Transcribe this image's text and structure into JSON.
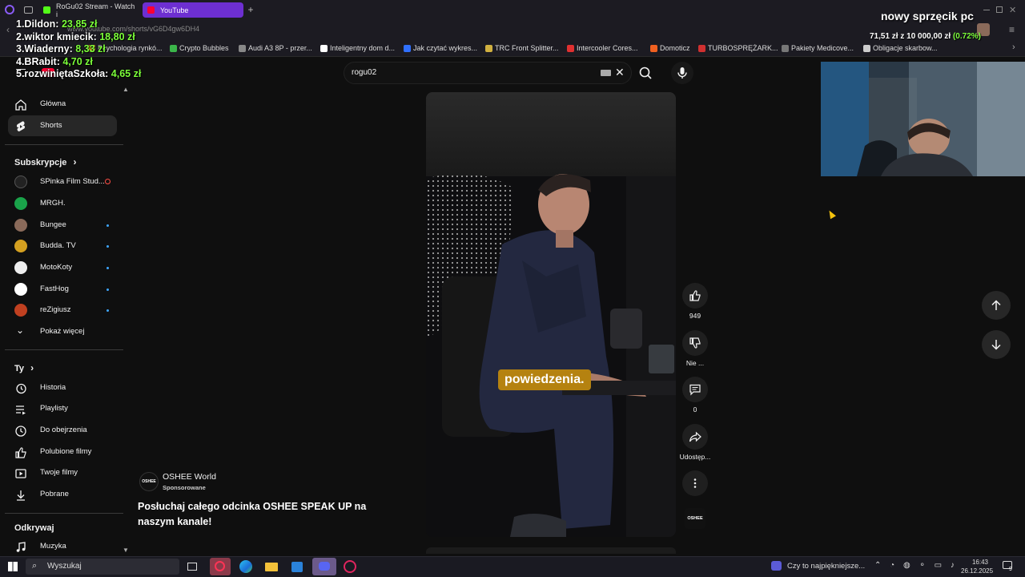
{
  "browser": {
    "tabs": [
      {
        "label": "RoGu02 Stream - Watch i",
        "color": "#53fc18"
      },
      {
        "label": "YouTube",
        "color": "#ff0033",
        "active": true
      }
    ],
    "new_tab": "+",
    "url": "www.youtube.com/shorts/vG6D4gw6DH4",
    "bookmarks": [
      {
        "label": "Psychologia rynkó...",
        "color": "#e0a020"
      },
      {
        "label": "Crypto Bubbles",
        "color": "#3bb54a"
      },
      {
        "label": "Audi A3 8P - przer...",
        "color": "#888888"
      },
      {
        "label": "Inteligentny dom d...",
        "color": "#ffffff"
      },
      {
        "label": "Jak czytać wykres...",
        "color": "#3070ff"
      },
      {
        "label": "TRC Front Splitter...",
        "color": "#d0b040"
      },
      {
        "label": "Intercooler Cores...",
        "color": "#e03030"
      },
      {
        "label": "Domoticz",
        "color": "#f06020"
      },
      {
        "label": "TURBOSPRĘŻARK...",
        "color": "#d03030"
      },
      {
        "label": "Pakiety Medicove...",
        "color": "#777777"
      },
      {
        "label": "Obligacje skarbow...",
        "color": "#cccccc"
      }
    ]
  },
  "overlay": {
    "leaderboard": [
      {
        "name": "1.Dildon:",
        "amount": "23,85 zł"
      },
      {
        "name": "2.wiktor kmiecik:",
        "amount": "18,80 zł"
      },
      {
        "name": "3.Wiaderny:",
        "amount": "8,33 zł"
      },
      {
        "name": "4.BRabit:",
        "amount": "4,70 zł"
      },
      {
        "name": "5.rozwiniętaSzkoła:",
        "amount": "4,65 zł"
      }
    ],
    "goal_title": "nowy sprzęcik pc",
    "goal_progress": "71,51 zł  z  10 000,00 zł",
    "goal_percent": "(0.72%)"
  },
  "youtube": {
    "sidebar": {
      "main": [
        {
          "label": "Główna",
          "icon": "home-icon"
        },
        {
          "label": "Shorts",
          "icon": "shorts-icon",
          "active": true
        }
      ],
      "subs_title": "Subskrypcje",
      "subs": [
        {
          "label": "SPinka Film Stud...",
          "color": "#222222",
          "live": true
        },
        {
          "label": "MRGH.",
          "color": "#1aa34a"
        },
        {
          "label": "Bungee",
          "color": "#8a6a5a",
          "dot": true
        },
        {
          "label": "Budda. TV",
          "color": "#d4a020",
          "dot": true
        },
        {
          "label": "MotoKoty",
          "color": "#eeeeee",
          "dot": true
        },
        {
          "label": "FastHog",
          "color": "#ffffff",
          "dot": true
        },
        {
          "label": "reZigiusz",
          "color": "#c04020",
          "dot": true
        }
      ],
      "show_more": "Pokaż więcej",
      "you_title": "Ty",
      "you": [
        {
          "label": "Historia",
          "icon": "history-icon"
        },
        {
          "label": "Playlisty",
          "icon": "playlist-icon"
        },
        {
          "label": "Do obejrzenia",
          "icon": "clock-icon"
        },
        {
          "label": "Polubione filmy",
          "icon": "thumb-up-icon"
        },
        {
          "label": "Twoje filmy",
          "icon": "video-icon"
        },
        {
          "label": "Pobrane",
          "icon": "download-icon"
        }
      ],
      "explore_title": "Odkrywaj",
      "explore": [
        {
          "label": "Muzyka",
          "icon": "music-icon"
        }
      ]
    },
    "search": {
      "query": "rogu02"
    },
    "short": {
      "caption": "powiedzenia.",
      "likes": "949",
      "dislike_label": "Nie ...",
      "comments": "0",
      "share_label": "Udostęp...",
      "channel": "OSHEE World",
      "sponsored": "Sponsorowane",
      "title": "Posłuchaj całego odcinka OSHEE SPEAK UP na naszym kanale!",
      "logo_text": "OSHEE"
    }
  },
  "taskbar": {
    "search_placeholder": "Wyszukaj",
    "news": "Czy to najpiękniejsze...",
    "time": "16:43",
    "date": "26.12.2025",
    "notifications": "9"
  }
}
